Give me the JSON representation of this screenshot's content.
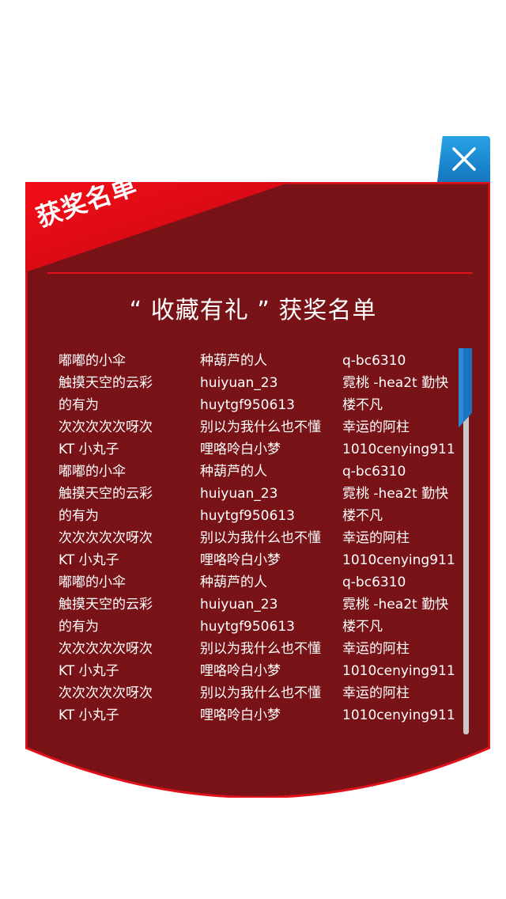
{
  "header": {
    "ribbon_label": "获奖名单",
    "title": "“ 收藏有礼 ” 获奖名单"
  },
  "colors": {
    "panel_fill": "#7e1418",
    "panel_border": "#e0111a",
    "ribbon": "#e40a14",
    "close_button": "#1a86cf",
    "scroll_thumb": "#1b73c0",
    "scroll_track": "#c9c9c9"
  },
  "icons": {
    "close": "close-icon"
  },
  "winners": {
    "rows": [
      [
        "嘟嘟的小伞",
        "种葫芦的人",
        "q-bc6310"
      ],
      [
        "触摸天空的云彩",
        "huiyuan_23",
        "霓桃 -hea2t 勤快"
      ],
      [
        "的有为",
        "huytgf950613",
        "楼不凡"
      ],
      [
        "次次次次次呀次",
        "别以为我什么也不懂",
        "幸运的阿柱"
      ],
      [
        "KT 小丸子",
        "哩咯呤白小梦",
        "1010cenying911"
      ],
      [
        "嘟嘟的小伞",
        "种葫芦的人",
        "q-bc6310"
      ],
      [
        "触摸天空的云彩",
        "huiyuan_23",
        "霓桃 -hea2t 勤快"
      ],
      [
        "的有为",
        "huytgf950613",
        "楼不凡"
      ],
      [
        "次次次次次呀次",
        "别以为我什么也不懂",
        "幸运的阿柱"
      ],
      [
        "KT 小丸子",
        "哩咯呤白小梦",
        "1010cenying911"
      ],
      [
        "嘟嘟的小伞",
        "种葫芦的人",
        "q-bc6310"
      ],
      [
        "触摸天空的云彩",
        "huiyuan_23",
        "霓桃 -hea2t 勤快"
      ],
      [
        "的有为",
        "huytgf950613",
        "楼不凡"
      ],
      [
        "次次次次次呀次",
        "别以为我什么也不懂",
        "幸运的阿柱"
      ],
      [
        "KT 小丸子",
        "哩咯呤白小梦",
        "1010cenying911"
      ],
      [
        "次次次次次呀次",
        "别以为我什么也不懂",
        "幸运的阿柱"
      ],
      [
        "KT 小丸子",
        "哩咯呤白小梦",
        "1010cenying911"
      ]
    ]
  }
}
